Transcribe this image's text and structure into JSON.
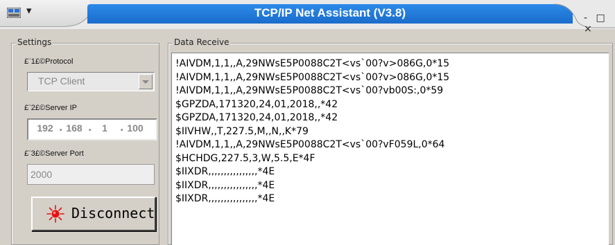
{
  "window": {
    "title": "TCP/IP Net Assistant (V3.8)",
    "controls": "- □ ×"
  },
  "settings": {
    "legend": "Settings",
    "protocol_label": "£¨1£©Protocol",
    "protocol_value": "TCP Client",
    "server_ip_label": "£¨2£©Server IP",
    "server_ip": [
      "192",
      "168",
      "1",
      "100"
    ],
    "server_port_label": "£¨3£©Server Port",
    "server_port": "2000",
    "connect_button_label": "Disconnect"
  },
  "receive": {
    "legend": "Data Receive",
    "lines": [
      "!AIVDM,1,1,,A,29NWsE5P0088C2T<vs`00?v>086G,0*15",
      "!AIVDM,1,1,,A,29NWsE5P0088C2T<vs`00?v>086G,0*15",
      "!AIVDM,1,1,,A,29NWsE5P0088C2T<vs`00?vb00S:,0*59",
      "$GPZDA,171320,24,01,2018,,*42",
      "$GPZDA,171320,24,01,2018,,*42",
      "$IIVHW,,T,227.5,M,,N,,K*79",
      "!AIVDM,1,1,,A,29NWsE5P0088C2T<vs`00?vF059L,0*64",
      "$HCHDG,227.5,3,W,5.5,E*4F",
      "$IIXDR,,,,,,,,,,,,,,,,*4E",
      "$IIXDR,,,,,,,,,,,,,,,,*4E",
      "$IIXDR,,,,,,,,,,,,,,,,*4E"
    ]
  },
  "colors": {
    "title_bar": "#1a6ccb",
    "window_bg": "#d4d0c8",
    "indicator_red": "#e81010"
  },
  "icons": {
    "app": "app-icon",
    "system_menu": "chevron-down-icon",
    "status_indicator": "red-status-light-icon"
  }
}
